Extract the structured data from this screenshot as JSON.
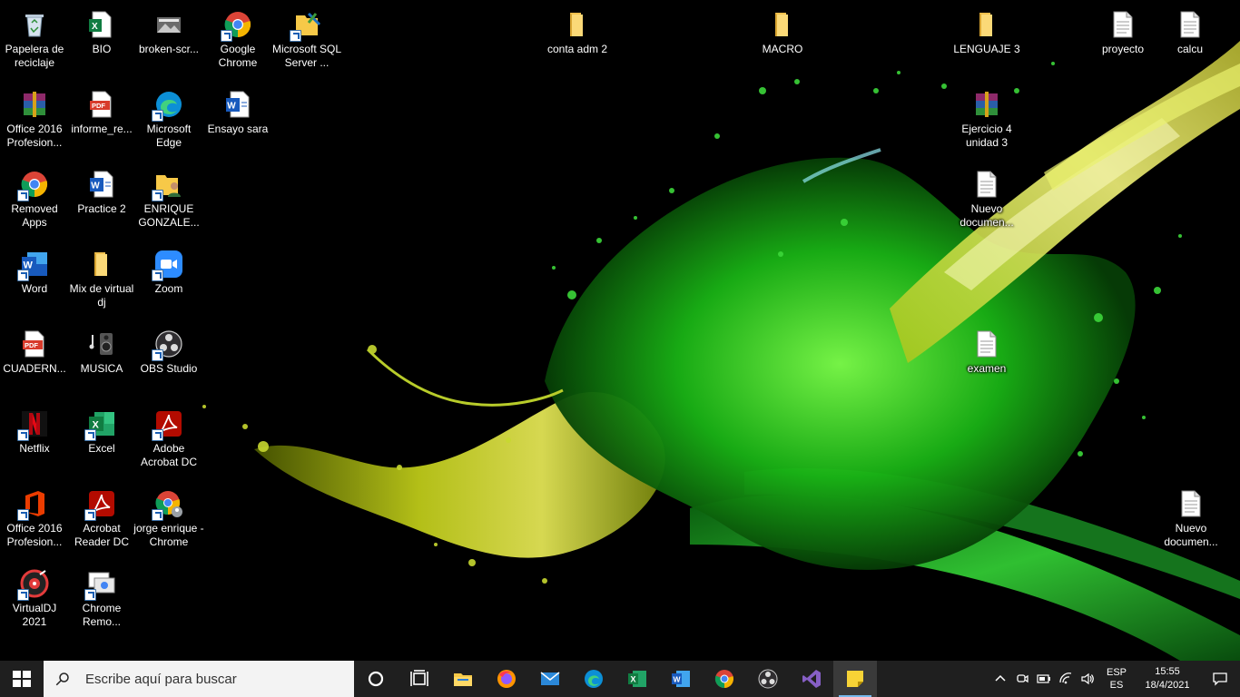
{
  "desktop": {
    "icons": [
      {
        "label": "Papelera de reciclaje",
        "icon": "recycle-bin-icon"
      },
      {
        "label": "BIO",
        "icon": "excel-file-icon"
      },
      {
        "label": "broken-scr...",
        "icon": "image-file-icon"
      },
      {
        "label": "Google Chrome",
        "icon": "chrome-icon"
      },
      {
        "label": "Microsoft SQL Server ...",
        "icon": "sql-server-icon"
      },
      {
        "label": "Office 2016 Profesion...",
        "icon": "winrar-icon"
      },
      {
        "label": "informe_re...",
        "icon": "pdf-file-icon"
      },
      {
        "label": "Microsoft Edge",
        "icon": "edge-icon"
      },
      {
        "label": "Ensayo sara",
        "icon": "word-file-icon"
      },
      {
        "label": "Removed Apps",
        "icon": "chrome-icon"
      },
      {
        "label": "Practice 2",
        "icon": "word-file-icon"
      },
      {
        "label": "ENRIQUE GONZALE...",
        "icon": "user-folder-icon"
      },
      {
        "label": "Word",
        "icon": "word-app-icon"
      },
      {
        "label": "Mix de virtual dj",
        "icon": "folder-icon"
      },
      {
        "label": "Zoom",
        "icon": "zoom-icon"
      },
      {
        "label": "CUADERN...",
        "icon": "pdf-file-icon"
      },
      {
        "label": "MUSICA",
        "icon": "music-icon"
      },
      {
        "label": "OBS Studio",
        "icon": "obs-icon"
      },
      {
        "label": "Netflix",
        "icon": "netflix-icon"
      },
      {
        "label": "Excel",
        "icon": "excel-app-icon"
      },
      {
        "label": "Adobe Acrobat DC",
        "icon": "acrobat-icon"
      },
      {
        "label": "Office 2016 Profesion...",
        "icon": "office-icon"
      },
      {
        "label": "Acrobat Reader DC",
        "icon": "acrobat-icon"
      },
      {
        "label": "jorge enrique - Chrome",
        "icon": "chrome-profile-icon"
      },
      {
        "label": "VirtualDJ 2021",
        "icon": "virtualdj-icon"
      },
      {
        "label": "Chrome Remo...",
        "icon": "chrome-remote-icon"
      },
      {
        "label": "conta adm 2",
        "icon": "folder-icon"
      },
      {
        "label": "MACRO",
        "icon": "folder-icon"
      },
      {
        "label": "LENGUAJE 3",
        "icon": "folder-icon"
      },
      {
        "label": "proyecto",
        "icon": "text-file-icon"
      },
      {
        "label": "calcu",
        "icon": "text-file-icon"
      },
      {
        "label": "Ejercicio 4 unidad 3",
        "icon": "winrar-icon"
      },
      {
        "label": "Nuevo documen...",
        "icon": "text-file-icon"
      },
      {
        "label": "examen",
        "icon": "text-file-icon"
      },
      {
        "label": "Nuevo documen...",
        "icon": "text-file-icon"
      }
    ]
  },
  "taskbar": {
    "search_placeholder": "Escribe aquí para buscar",
    "pinned": [
      {
        "icon": "cortana-icon"
      },
      {
        "icon": "task-view-icon"
      },
      {
        "icon": "file-explorer-icon"
      },
      {
        "icon": "firefox-icon"
      },
      {
        "icon": "mail-icon"
      },
      {
        "icon": "edge-icon"
      },
      {
        "icon": "excel-icon"
      },
      {
        "icon": "word-icon"
      },
      {
        "icon": "chrome-icon"
      },
      {
        "icon": "obs-icon"
      },
      {
        "icon": "visual-studio-icon"
      },
      {
        "icon": "sticky-notes-icon"
      }
    ],
    "tray": {
      "lang_top": "ESP",
      "lang_bottom": "ES",
      "time": "15:55",
      "date": "18/4/2021"
    }
  },
  "colors": {
    "taskbar": "#1f1f1f",
    "search_bg": "#f3f3f3",
    "accent": "#76b9ed",
    "splash_green": "#1fd21f",
    "splash_yellow": "#d8e021"
  }
}
